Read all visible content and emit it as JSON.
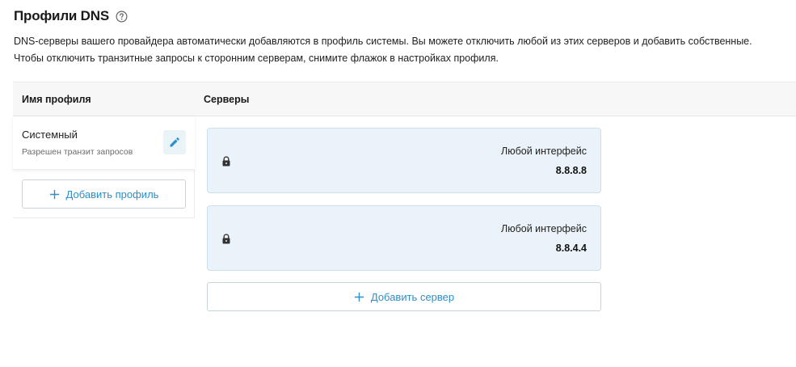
{
  "header": {
    "title": "Профили DNS",
    "help_icon": "question-circle-icon"
  },
  "description": {
    "line1": "DNS-серверы вашего провайдера автоматически добавляются в профиль системы. Вы можете отключить любой из этих серверов и добавить собственные.",
    "line2": "Чтобы отключить транзитные запросы к сторонним серверам, снимите флажок в настройках профиля."
  },
  "table": {
    "col_profile_name": "Имя профиля",
    "col_servers": "Серверы"
  },
  "profiles": [
    {
      "name": "Системный",
      "subtitle": "Разрешен транзит запросов",
      "edit_icon": "pencil-icon"
    }
  ],
  "add_profile_label": "Добавить профиль",
  "servers": [
    {
      "interface": "Любой интерфейс",
      "address": "8.8.8.8",
      "icon": "lock-icon"
    },
    {
      "interface": "Любой интерфейс",
      "address": "8.8.4.4",
      "icon": "lock-icon"
    }
  ],
  "add_server_label": "Добавить сервер",
  "colors": {
    "accent": "#2f8fc7",
    "server_card_bg": "#eaf3f9",
    "server_card_border": "#cde0ec",
    "header_bg": "#f7f7f7"
  }
}
